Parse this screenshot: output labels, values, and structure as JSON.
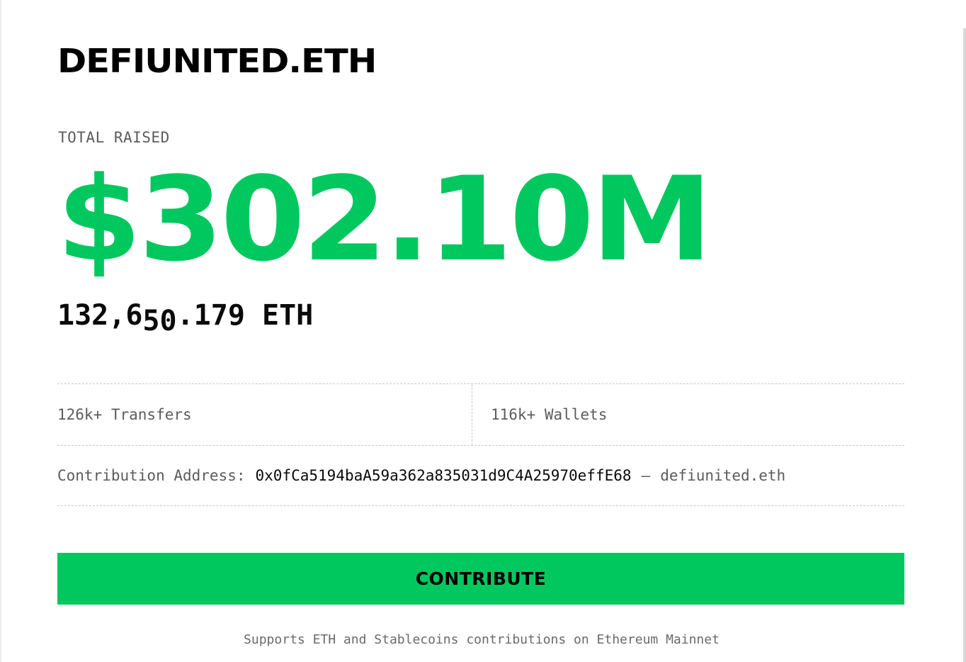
{
  "header": {
    "title": "DEFIUNITED.ETH"
  },
  "raised": {
    "label": "TOTAL RAISED",
    "amount": "$302.10M",
    "eth_prefix": "132,6",
    "eth_roll": "50",
    "eth_suffix": ".179 ETH"
  },
  "stats": {
    "transfers": "126k+ Transfers",
    "wallets": "116k+ Wallets"
  },
  "contribution": {
    "label": "Contribution Address:",
    "address": "0x0fCa5194baA59a362a835031d9C4A25970effE68",
    "separator": "—",
    "ens": "defiunited.eth"
  },
  "cta": {
    "label": "CONTRIBUTE"
  },
  "footer": {
    "note": "Supports ETH and Stablecoins contributions on Ethereum Mainnet"
  },
  "colors": {
    "accent": "#00c85f",
    "text": "#000000",
    "muted": "#5c5c5c"
  }
}
